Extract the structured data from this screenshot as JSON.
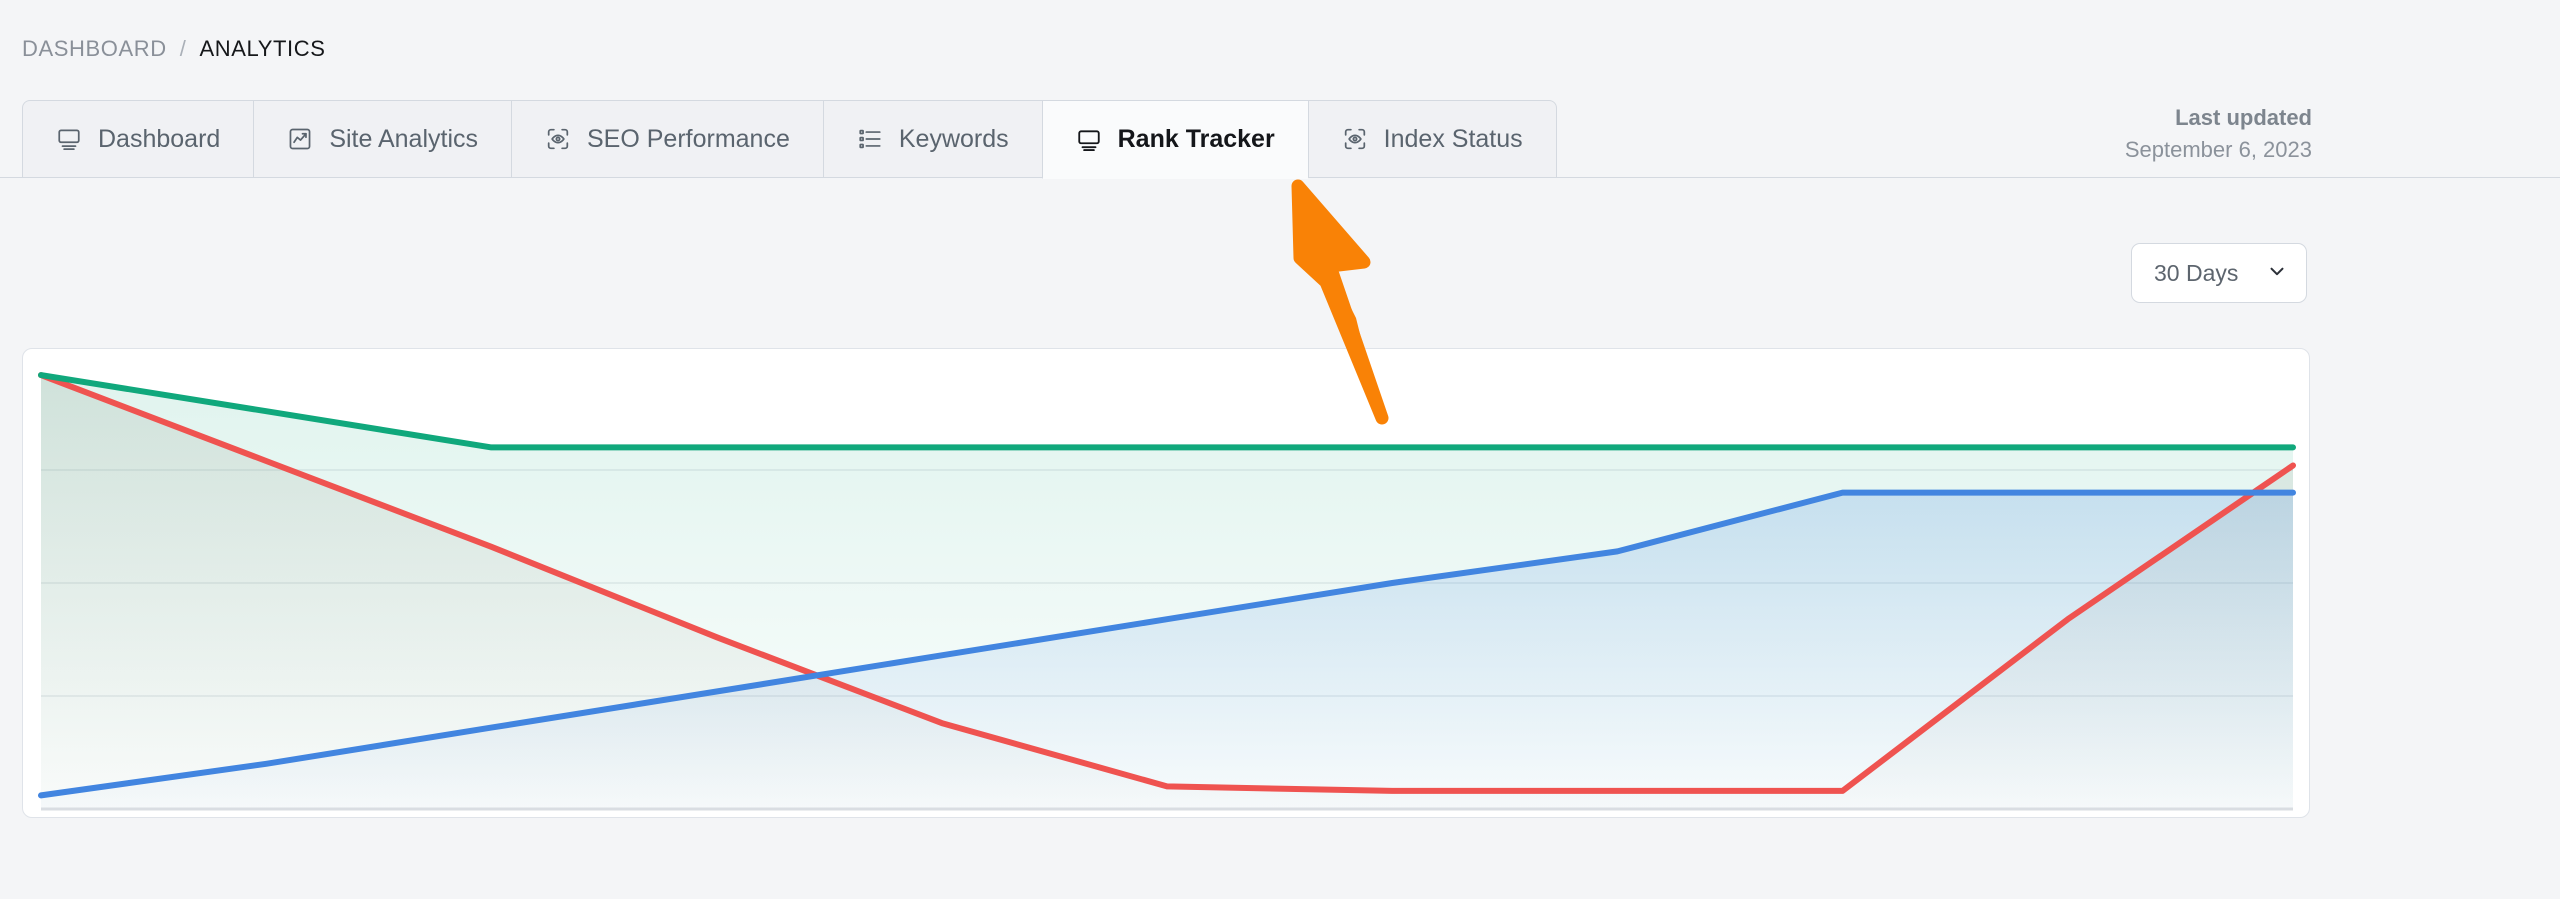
{
  "breadcrumb": {
    "root": "DASHBOARD",
    "separator": "/",
    "current": "ANALYTICS"
  },
  "tabs": [
    {
      "label": "Dashboard",
      "icon": "monitor-icon",
      "active": false
    },
    {
      "label": "Site Analytics",
      "icon": "chart-box-icon",
      "active": false
    },
    {
      "label": "SEO Performance",
      "icon": "scan-eye-icon",
      "active": false
    },
    {
      "label": "Keywords",
      "icon": "list-icon",
      "active": false
    },
    {
      "label": "Rank Tracker",
      "icon": "monitor-icon",
      "active": true
    },
    {
      "label": "Index Status",
      "icon": "scan-eye-icon",
      "active": false
    }
  ],
  "last_updated": {
    "title": "Last updated",
    "date": "September 6, 2023"
  },
  "range_select": {
    "value": "30 Days",
    "chevron": "chevron-down-icon"
  },
  "colors": {
    "green": "#10a87c",
    "red": "#ef5350",
    "blue": "#4285e0",
    "accent_arrow": "#f98206",
    "page_bg": "#f4f5f7",
    "card_bg": "#ffffff",
    "border": "#d4d9e0"
  },
  "chart_data": {
    "type": "area",
    "title": "",
    "xlabel": "",
    "ylabel": "",
    "grid": true,
    "legend": "none",
    "xlim": [
      0,
      10
    ],
    "ylim": [
      0,
      100
    ],
    "x": [
      0,
      1,
      2,
      3,
      4,
      5,
      6,
      7,
      8,
      9,
      10
    ],
    "series": [
      {
        "name": "green",
        "color": "#10a87c",
        "values": [
          96,
          88,
          80,
          80,
          80,
          80,
          80,
          80,
          80,
          80,
          80
        ]
      },
      {
        "name": "red",
        "color": "#ef5350",
        "values": [
          96,
          77,
          58,
          38,
          19,
          5,
          4,
          4,
          4,
          42,
          76
        ]
      },
      {
        "name": "blue",
        "color": "#4285e0",
        "values": [
          3,
          10,
          18,
          26,
          34,
          42,
          50,
          57,
          70,
          70,
          70
        ]
      }
    ]
  }
}
